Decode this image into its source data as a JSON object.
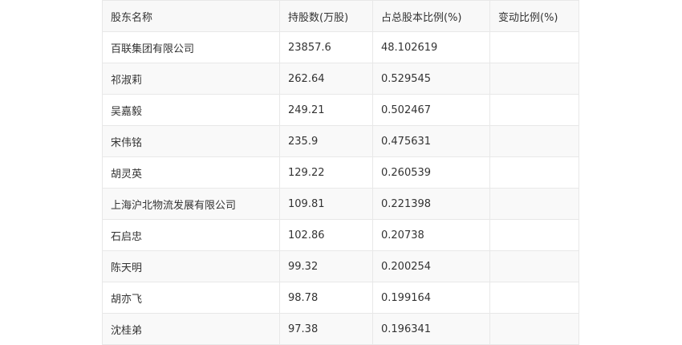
{
  "table": {
    "headers": [
      "股东名称",
      "持股数(万股)",
      "占总股本比例(%)",
      "变动比例(%)"
    ],
    "rows": [
      [
        "百联集团有限公司",
        "23857.6",
        "48.102619",
        ""
      ],
      [
        "祁淑莉",
        "262.64",
        "0.529545",
        ""
      ],
      [
        "吴嘉毅",
        "249.21",
        "0.502467",
        ""
      ],
      [
        "宋伟铭",
        "235.9",
        "0.475631",
        ""
      ],
      [
        "胡灵英",
        "129.22",
        "0.260539",
        ""
      ],
      [
        "上海沪北物流发展有限公司",
        "109.81",
        "0.221398",
        ""
      ],
      [
        "石启忠",
        "102.86",
        "0.20738",
        ""
      ],
      [
        "陈天明",
        "99.32",
        "0.200254",
        ""
      ],
      [
        "胡亦飞",
        "98.78",
        "0.199164",
        ""
      ],
      [
        "沈桂弟",
        "97.38",
        "0.196341",
        ""
      ]
    ]
  }
}
